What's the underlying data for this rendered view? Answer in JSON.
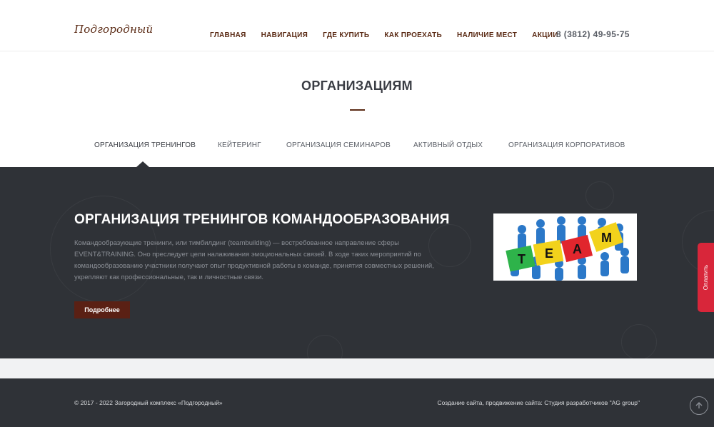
{
  "header": {
    "logo": "Подгородный",
    "nav": [
      "ГЛАВНАЯ",
      "НАВИГАЦИЯ",
      "ГДЕ КУПИТЬ",
      "КАК ПРОЕХАТЬ",
      "НАЛИЧИЕ МЕСТ",
      "АКЦИИ"
    ],
    "phone": "8 (3812) 49-95-75"
  },
  "section": {
    "title": "ОРГАНИЗАЦИЯМ"
  },
  "tabs": [
    "ОРГАНИЗАЦИЯ ТРЕНИНГОВ",
    "КЕЙТЕРИНГ",
    "ОРГАНИЗАЦИЯ СЕМИНАРОВ",
    "АКТИВНЫЙ ОТДЫХ",
    "ОРГАНИЗАЦИЯ КОРПОРАТИВОВ"
  ],
  "active_tab": "ОРГАНИЗАЦИЯ ТРЕНИНГОВ",
  "panel": {
    "heading": "ОРГАНИЗАЦИЯ ТРЕНИНГОВ КОМАНДООБРАЗОВАНИЯ",
    "text": "Командообразующие тренинги, или тимбилдинг (teambuilding) — востребованное направление сферы EVENT&TRAINING. Оно преследует цели налаживания эмоциональных связей. В ходе таких мероприятий по командообразованию участники получают опыт продуктивной работы в команде, принятия совместных решений, укрепляют как профессиональные, так и личностные связи.",
    "button": "Подробнее",
    "image_letters": [
      "T",
      "E",
      "A",
      "M"
    ]
  },
  "footer": {
    "copyright": "© 2017 - 2022 Загородный комплекс «Подгородный»",
    "credit": "Создание сайта, продвижение сайта: Студия разработчиков \"AG group\""
  },
  "side_tab": "Оплатить",
  "colors": {
    "brand": "#5a2a14",
    "panel_bg": "#2f3237",
    "button_bg": "#5a2014",
    "pay_tab": "#d8263a"
  },
  "icons": [
    "arrow-up-icon"
  ]
}
